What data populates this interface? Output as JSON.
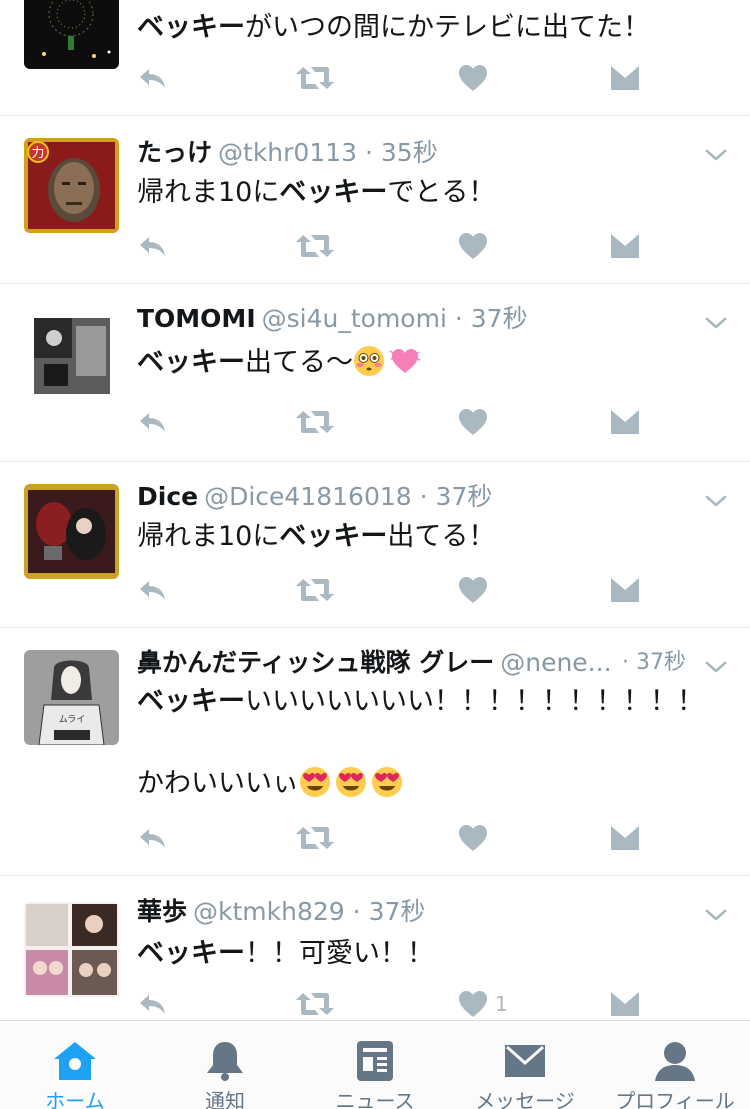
{
  "colors": {
    "accent": "#1da1f2",
    "icon_gray": "#aab8c2",
    "text_gray": "#8899a6",
    "divider": "#e1e8ed"
  },
  "tweets": [
    {
      "avatar": "fireworks-avatar",
      "body_bold": "ベッキー",
      "body_rest": "がいつの間にかテレビに出てた！"
    },
    {
      "avatar": "man-face-avatar",
      "name": "たっけ",
      "handle": "@tkhr0113",
      "sep": "·",
      "time": "35秒",
      "body_pre": "帰れま10に",
      "body_bold": "ベッキー",
      "body_rest": "でとる！"
    },
    {
      "avatar": "mono-photo-avatar",
      "name": "TOMOMI",
      "handle": "@si4u_tomomi",
      "sep": "·",
      "time": "37秒",
      "body_bold": "ベッキー",
      "body_rest": "出てる〜",
      "emojis": [
        "flushed-face-emoji",
        "heart-emoji"
      ]
    },
    {
      "avatar": "game-card-avatar",
      "name": "Dice",
      "handle": "@Dice41816018",
      "sep": "·",
      "time": "37秒",
      "body_pre": "帰れま10に",
      "body_bold": "ベッキー",
      "body_rest": "出てる！"
    },
    {
      "avatar": "illustration-avatar",
      "name": "鼻かんだティッシュ戦隊 グレー",
      "handle": "@nene...",
      "sep": "·",
      "time": "37秒",
      "body_bold": "ベッキー",
      "body_rest": "いいいいいいい！！！！！！！！！！",
      "body_line2": "かわいいいぃ",
      "emojis": [
        "heart-eyes-emoji",
        "heart-eyes-emoji",
        "heart-eyes-emoji"
      ]
    },
    {
      "avatar": "collage-avatar",
      "name": "華歩",
      "handle": "@ktmkh829",
      "sep": "·",
      "time": "37秒",
      "body_bold": "ベッキー",
      "body_rest": "！！可愛い！！",
      "like_count": "1"
    }
  ],
  "tabbar": [
    {
      "label": "ホーム",
      "icon": "home-icon",
      "active": true
    },
    {
      "label": "通知",
      "icon": "bell-icon",
      "active": false
    },
    {
      "label": "ニュース",
      "icon": "news-icon",
      "active": false
    },
    {
      "label": "メッセージ",
      "icon": "envelope-icon",
      "active": false
    },
    {
      "label": "プロフィール",
      "icon": "person-icon",
      "active": false
    }
  ]
}
